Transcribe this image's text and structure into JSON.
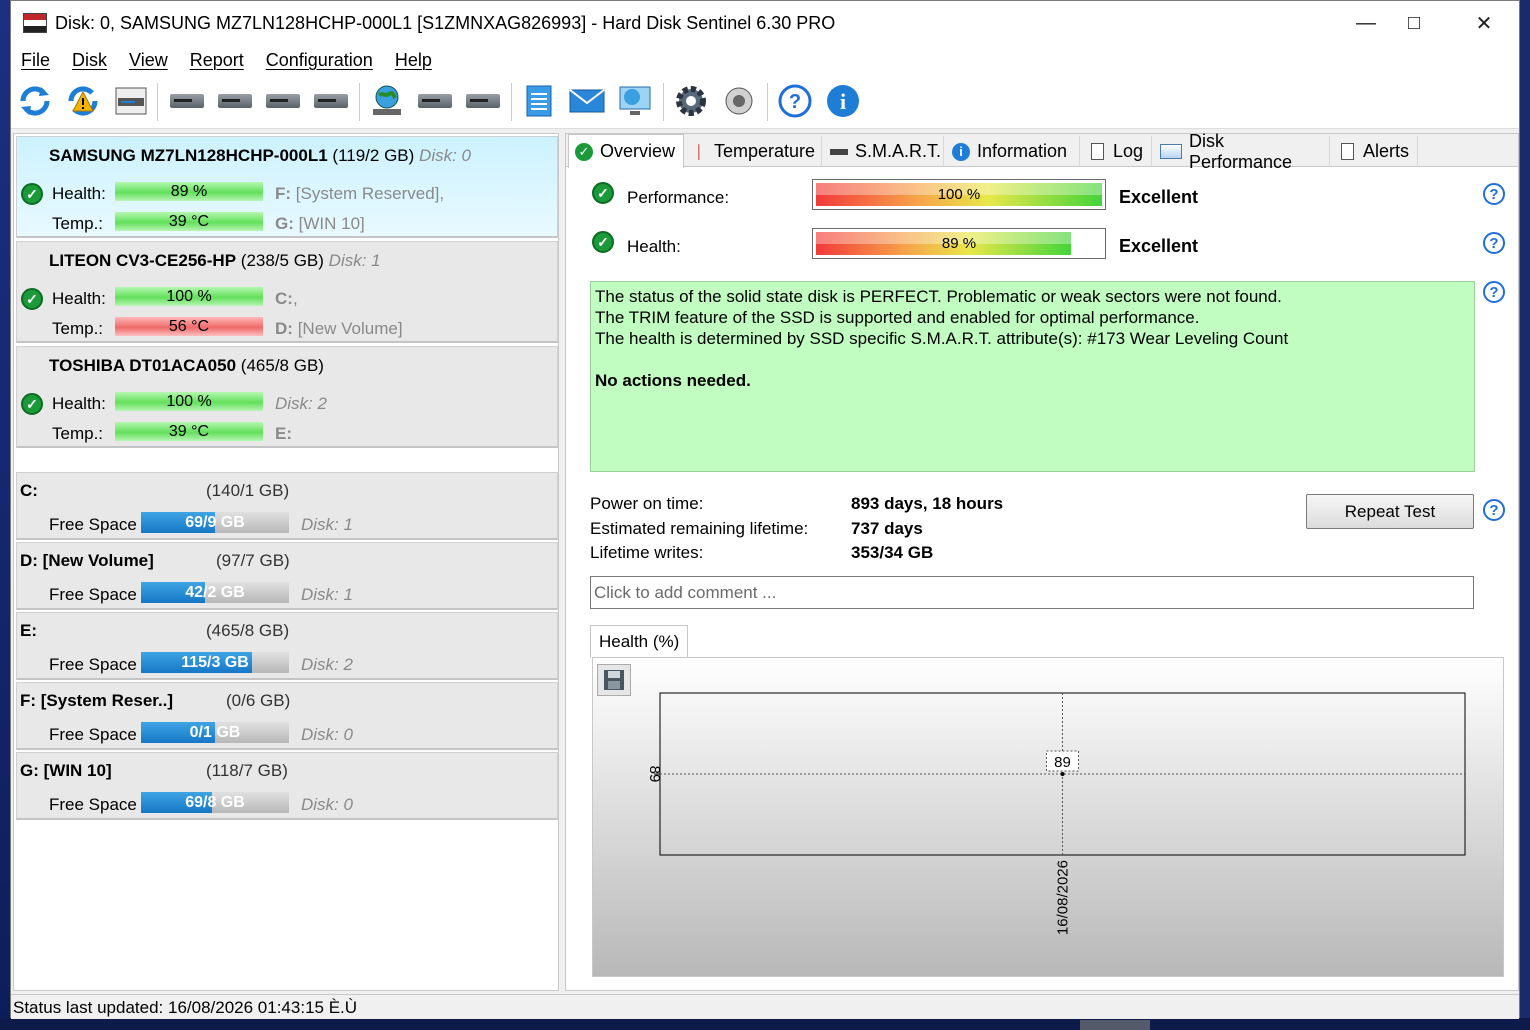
{
  "window": {
    "title": "Disk: 0, SAMSUNG MZ7LN128HCHP-000L1 [S1ZMNXAG826993]  -  Hard Disk Sentinel 6.30 PRO"
  },
  "menu": [
    "File",
    "Disk",
    "View",
    "Report",
    "Configuration",
    "Help"
  ],
  "toolbar_icons": [
    "refresh-icon",
    "refresh-warning-icon",
    "disk-list-icon",
    "disk-details-icon",
    "disk-schedule-icon",
    "disk-ok-icon",
    "disk-search-icon",
    "network-globe-icon",
    "disk-cloud-icon",
    "disk-usb-icon",
    "notepad-icon",
    "email-icon",
    "monitor-globe-icon",
    "settings-gear-icon",
    "speaker-icon",
    "help-icon",
    "info-icon"
  ],
  "disks": [
    {
      "name": "SAMSUNG MZ7LN128HCHP-000L1",
      "size": "(119/2 GB)",
      "disk_no": "Disk: 0",
      "health_label": "Health:",
      "health": "89 %",
      "health_pct": 89,
      "temp_label": "Temp.:",
      "temp": "39 °C",
      "temp_status": "ok",
      "vol1_letter": "F:",
      "vol1_name": "[System Reserved],",
      "vol2_letter": "G:",
      "vol2_name": "[WIN 10]"
    },
    {
      "name": "LITEON CV3-CE256-HP",
      "size": "(238/5 GB)",
      "disk_no": "Disk: 1",
      "health_label": "Health:",
      "health": "100 %",
      "health_pct": 100,
      "temp_label": "Temp.:",
      "temp": "56 °C",
      "temp_status": "hot",
      "vol1_letter": "C:",
      "vol1_name": ",",
      "vol2_letter": "D:",
      "vol2_name": "[New Volume]"
    },
    {
      "name": "TOSHIBA DT01ACA050",
      "size": "(465/8 GB)",
      "disk_no": "",
      "health_label": "Health:",
      "health": "100 %",
      "health_pct": 100,
      "temp_label": "Temp.:",
      "temp": "39 °C",
      "temp_status": "ok",
      "vol1_letter": "",
      "vol1_name": "Disk: 2",
      "vol2_letter": "E:",
      "vol2_name": ""
    }
  ],
  "partitions": [
    {
      "name": "C:",
      "size": "(140/1 GB)",
      "free_label": "Free Space",
      "free": "69/9 GB",
      "free_pct": 50,
      "disk": "Disk: 1"
    },
    {
      "name": "D: [New Volume]",
      "size": "(97/7 GB)",
      "free_label": "Free Space",
      "free": "42/2 GB",
      "free_pct": 43,
      "disk": "Disk: 1"
    },
    {
      "name": "E:",
      "size": "(465/8 GB)",
      "free_label": "Free Space",
      "free": "115/3 GB",
      "free_pct": 75,
      "disk": "Disk: 2"
    },
    {
      "name": "F: [System Reser..]",
      "size": "(0/6 GB)",
      "free_label": "Free Space",
      "free": "0/1 GB",
      "free_pct": 50,
      "disk": "Disk: 0"
    },
    {
      "name": "G: [WIN 10]",
      "size": "(118/7 GB)",
      "free_label": "Free Space",
      "free": "69/8 GB",
      "free_pct": 48,
      "disk": "Disk: 0"
    }
  ],
  "tabs": [
    "Overview",
    "Temperature",
    "S.M.A.R.T.",
    "Information",
    "Log",
    "Disk Performance",
    "Alerts"
  ],
  "overview": {
    "performance_label": "Performance:",
    "performance": "100 %",
    "performance_pct": 100,
    "performance_rating": "Excellent",
    "health_label": "Health:",
    "health": "89 %",
    "health_pct": 89,
    "health_rating": "Excellent",
    "status_lines": [
      "The status of the solid state disk is PERFECT. Problematic or weak sectors were not found.",
      "The TRIM feature of the SSD is supported and enabled for optimal performance.",
      "The health is determined by SSD specific S.M.A.R.T. attribute(s):  #173 Wear Leveling Count"
    ],
    "status_action": "No actions needed.",
    "power_on_label": "Power on time:",
    "power_on": "893 days, 18 hours",
    "remaining_label": "Estimated remaining lifetime:",
    "remaining": "737 days",
    "writes_label": "Lifetime writes:",
    "writes": "353/34 GB",
    "repeat_test": "Repeat Test",
    "comment_placeholder": "Click to add comment ...",
    "chart_tab": "Health (%)"
  },
  "chart_data": {
    "type": "line",
    "x": [
      "16/08/2026"
    ],
    "series": [
      {
        "values": [
          89
        ]
      }
    ],
    "xlabel": "",
    "ylabel": "",
    "y_tick_labels": [
      "89"
    ],
    "data_labels": [
      "89"
    ],
    "grid": true
  },
  "statusbar": "Status last updated: 16/08/2026 01:43:15 È.Ù"
}
